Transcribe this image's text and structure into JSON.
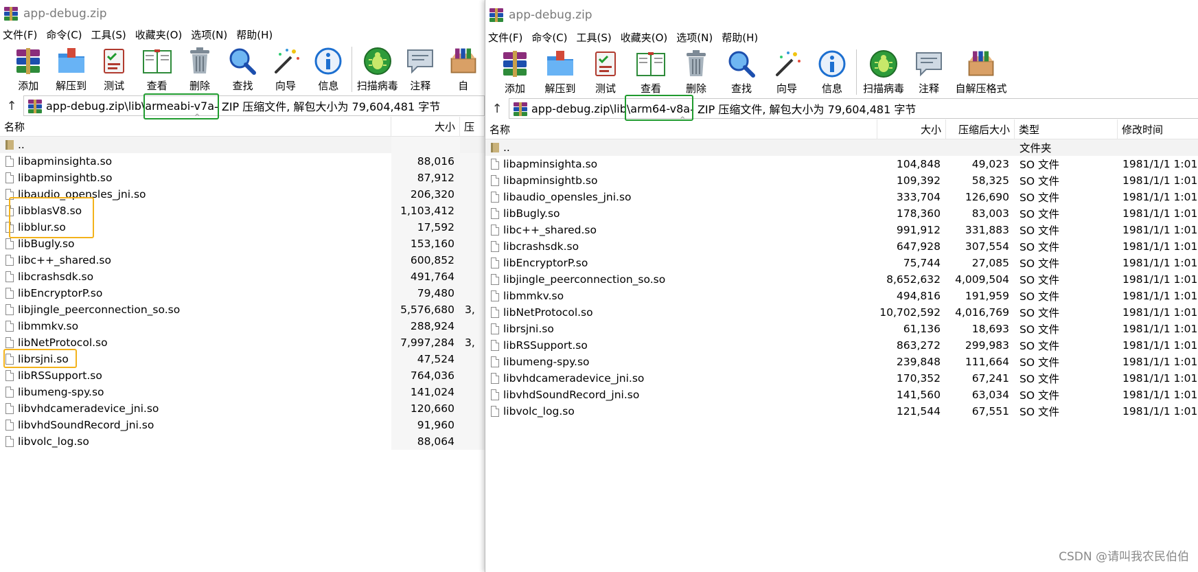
{
  "left": {
    "title": "app-debug.zip",
    "menu": [
      "文件(F)",
      "命令(C)",
      "工具(S)",
      "收藏夹(O)",
      "选项(N)",
      "帮助(H)"
    ],
    "toolbar": [
      "添加",
      "解压到",
      "测试",
      "查看",
      "删除",
      "查找",
      "向导",
      "信息",
      "扫描病毒",
      "注释",
      "自"
    ],
    "up_arrow": "↑",
    "path_prefix": "app-debug.zip\\lib\\",
    "path_folder": "armeabi-v7a",
    "path_suffix": " - ZIP 压缩文件, 解包大小为 79,604,481 字节",
    "headers": {
      "name": "名称",
      "size": "大小",
      "packed": "压"
    },
    "parent": "..",
    "files": [
      {
        "name": "libapminsighta.so",
        "size": "88,016",
        "packed": ""
      },
      {
        "name": "libapminsightb.so",
        "size": "87,912",
        "packed": ""
      },
      {
        "name": "libaudio_opensles_jni.so",
        "size": "206,320",
        "packed": ""
      },
      {
        "name": "libblasV8.so",
        "size": "1,103,412",
        "packed": ""
      },
      {
        "name": "libblur.so",
        "size": "17,592",
        "packed": ""
      },
      {
        "name": "libBugly.so",
        "size": "153,160",
        "packed": ""
      },
      {
        "name": "libc++_shared.so",
        "size": "600,852",
        "packed": ""
      },
      {
        "name": "libcrashsdk.so",
        "size": "491,764",
        "packed": ""
      },
      {
        "name": "libEncryptorP.so",
        "size": "79,480",
        "packed": ""
      },
      {
        "name": "libjingle_peerconnection_so.so",
        "size": "5,576,680",
        "packed": "3,"
      },
      {
        "name": "libmmkv.so",
        "size": "288,924",
        "packed": ""
      },
      {
        "name": "libNetProtocol.so",
        "size": "7,997,284",
        "packed": "3,"
      },
      {
        "name": "librsjni.so",
        "size": "47,524",
        "packed": ""
      },
      {
        "name": "libRSSupport.so",
        "size": "764,036",
        "packed": ""
      },
      {
        "name": "libumeng-spy.so",
        "size": "141,024",
        "packed": ""
      },
      {
        "name": "libvhdcameradevice_jni.so",
        "size": "120,660",
        "packed": ""
      },
      {
        "name": "libvhdSoundRecord_jni.so",
        "size": "91,960",
        "packed": ""
      },
      {
        "name": "libvolc_log.so",
        "size": "88,064",
        "packed": ""
      }
    ]
  },
  "right": {
    "title": "app-debug.zip",
    "menu": [
      "文件(F)",
      "命令(C)",
      "工具(S)",
      "收藏夹(O)",
      "选项(N)",
      "帮助(H)"
    ],
    "toolbar": [
      "添加",
      "解压到",
      "测试",
      "查看",
      "删除",
      "查找",
      "向导",
      "信息",
      "扫描病毒",
      "注释",
      "自解压格式"
    ],
    "up_arrow": "↑",
    "path_prefix": "app-debug.zip\\lib\\",
    "path_folder": "arm64-v8a",
    "path_suffix": " - ZIP 压缩文件, 解包大小为 79,604,481 字节",
    "headers": {
      "name": "名称",
      "size": "大小",
      "packed": "压缩后大小",
      "type": "类型",
      "mtime": "修改时间"
    },
    "parent": "..",
    "parent_type": "文件夹",
    "files": [
      {
        "name": "libapminsighta.so",
        "size": "104,848",
        "packed": "49,023",
        "type": "SO 文件",
        "mtime": "1981/1/1 1:01"
      },
      {
        "name": "libapminsightb.so",
        "size": "109,392",
        "packed": "58,325",
        "type": "SO 文件",
        "mtime": "1981/1/1 1:01"
      },
      {
        "name": "libaudio_opensles_jni.so",
        "size": "333,704",
        "packed": "126,690",
        "type": "SO 文件",
        "mtime": "1981/1/1 1:01"
      },
      {
        "name": "libBugly.so",
        "size": "178,360",
        "packed": "83,003",
        "type": "SO 文件",
        "mtime": "1981/1/1 1:01"
      },
      {
        "name": "libc++_shared.so",
        "size": "991,912",
        "packed": "331,883",
        "type": "SO 文件",
        "mtime": "1981/1/1 1:01"
      },
      {
        "name": "libcrashsdk.so",
        "size": "647,928",
        "packed": "307,554",
        "type": "SO 文件",
        "mtime": "1981/1/1 1:01"
      },
      {
        "name": "libEncryptorP.so",
        "size": "75,744",
        "packed": "27,085",
        "type": "SO 文件",
        "mtime": "1981/1/1 1:01"
      },
      {
        "name": "libjingle_peerconnection_so.so",
        "size": "8,652,632",
        "packed": "4,009,504",
        "type": "SO 文件",
        "mtime": "1981/1/1 1:01"
      },
      {
        "name": "libmmkv.so",
        "size": "494,816",
        "packed": "191,959",
        "type": "SO 文件",
        "mtime": "1981/1/1 1:01"
      },
      {
        "name": "libNetProtocol.so",
        "size": "10,702,592",
        "packed": "4,016,769",
        "type": "SO 文件",
        "mtime": "1981/1/1 1:01"
      },
      {
        "name": "librsjni.so",
        "size": "61,136",
        "packed": "18,693",
        "type": "SO 文件",
        "mtime": "1981/1/1 1:01"
      },
      {
        "name": "libRSSupport.so",
        "size": "863,272",
        "packed": "299,983",
        "type": "SO 文件",
        "mtime": "1981/1/1 1:01"
      },
      {
        "name": "libumeng-spy.so",
        "size": "239,848",
        "packed": "111,664",
        "type": "SO 文件",
        "mtime": "1981/1/1 1:01"
      },
      {
        "name": "libvhdcameradevice_jni.so",
        "size": "170,352",
        "packed": "67,241",
        "type": "SO 文件",
        "mtime": "1981/1/1 1:01"
      },
      {
        "name": "libvhdSoundRecord_jni.so",
        "size": "141,560",
        "packed": "63,034",
        "type": "SO 文件",
        "mtime": "1981/1/1 1:01"
      },
      {
        "name": "libvolc_log.so",
        "size": "121,544",
        "packed": "67,551",
        "type": "SO 文件",
        "mtime": "1981/1/1 1:01"
      }
    ]
  },
  "icons": {
    "toolbar": [
      "add-icon",
      "extract-icon",
      "test-icon",
      "view-icon",
      "delete-icon",
      "find-icon",
      "wizard-icon",
      "info-icon",
      "virus-scan-icon",
      "comment-icon",
      "sfx-icon"
    ]
  },
  "colors": {
    "highlight_green": "#1f9b2e",
    "highlight_orange": "#f3b21a"
  },
  "watermark": "CSDN @请叫我农民伯伯"
}
